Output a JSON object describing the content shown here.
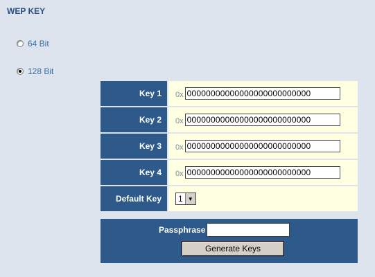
{
  "section": {
    "title": "WEP KEY"
  },
  "options": [
    {
      "label": "64 Bit",
      "checked": false
    },
    {
      "label": "128 Bit",
      "checked": true
    }
  ],
  "keys": [
    {
      "label": "Key 1",
      "prefix": "0x",
      "value": "00000000000000000000000000"
    },
    {
      "label": "Key 2",
      "prefix": "0x",
      "value": "00000000000000000000000000"
    },
    {
      "label": "Key 3",
      "prefix": "0x",
      "value": "00000000000000000000000000"
    },
    {
      "label": "Key 4",
      "prefix": "0x",
      "value": "00000000000000000000000000"
    }
  ],
  "default_key": {
    "label": "Default Key",
    "selected": "1"
  },
  "passphrase": {
    "label": "Passphrase",
    "value": ""
  },
  "generate_button": {
    "label": "Generate Keys"
  },
  "colors": {
    "background": "#dde4ee",
    "header_blue": "#2d5a8a",
    "cell_yellow": "#ffffe1",
    "title_blue": "#2a4f80"
  }
}
